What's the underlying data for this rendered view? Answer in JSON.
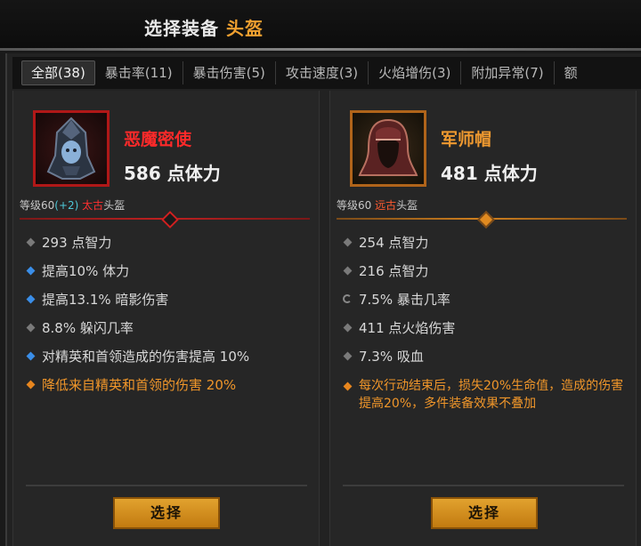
{
  "header": {
    "title_prefix": "选择装备",
    "title_slot": "头盔"
  },
  "tabs": [
    {
      "label": "全部(38)",
      "active": true
    },
    {
      "label": "暴击率(11)"
    },
    {
      "label": "暴击伤害(5)"
    },
    {
      "label": "攻击速度(3)"
    },
    {
      "label": "火焰增伤(3)"
    },
    {
      "label": "附加异常(7)"
    },
    {
      "label": "额"
    }
  ],
  "items": [
    {
      "name": "恶魔密使",
      "power": "586 点体力",
      "level": "等级60",
      "level_bonus": "(+2)",
      "rarity": "太古",
      "slot": "头盔",
      "name_color": "#ff2a2a",
      "affixes": [
        {
          "bullet": "gray",
          "text": "293 点智力"
        },
        {
          "bullet": "blue",
          "text": "提高10% 体力"
        },
        {
          "bullet": "blue",
          "text": "提高13.1% 暗影伤害"
        },
        {
          "bullet": "gray",
          "text": "8.8% 躲闪几率"
        },
        {
          "bullet": "blue",
          "text": "对精英和首领造成的伤害提高 10%"
        },
        {
          "bullet": "orange",
          "text": "降低来自精英和首领的伤害 20%"
        }
      ],
      "button": "选择"
    },
    {
      "name": "军师帽",
      "power": "481 点体力",
      "level": "等级60",
      "rarity": "远古",
      "slot": "头盔",
      "name_color": "#f09a30",
      "affixes": [
        {
          "bullet": "gray",
          "text": "254 点智力"
        },
        {
          "bullet": "gray",
          "text": "216 点智力"
        },
        {
          "bullet": "cycle",
          "text": "7.5% 暴击几率"
        },
        {
          "bullet": "gray",
          "text": "411 点火焰伤害"
        },
        {
          "bullet": "gray",
          "text": "7.3% 吸血"
        },
        {
          "bullet": "orange",
          "text": "每次行动结束后，损失20%生命值，造成的伤害提高20%，多件装备效果不叠加"
        }
      ],
      "button": "选择"
    }
  ]
}
